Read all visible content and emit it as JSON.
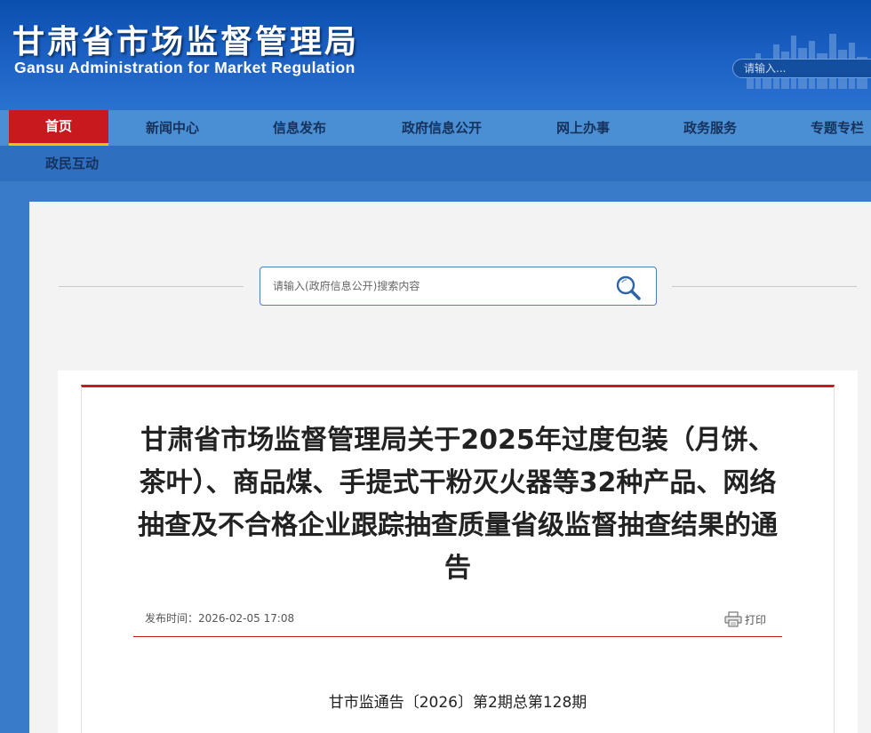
{
  "header": {
    "title_cn": "甘肃省市场监督管理局",
    "title_en": "Gansu Administration for Market Regulation",
    "search_placeholder": "请输入..."
  },
  "nav": {
    "items": [
      {
        "label": "首页",
        "active": true
      },
      {
        "label": "新闻中心"
      },
      {
        "label": "信息发布"
      },
      {
        "label": "政府信息公开"
      },
      {
        "label": "网上办事"
      },
      {
        "label": "政务服务"
      },
      {
        "label": "专题专栏"
      },
      {
        "label": "政民互动"
      }
    ]
  },
  "search": {
    "placeholder": "请输入(政府信息公开)搜索内容",
    "icon": "search-icon"
  },
  "article": {
    "title": "甘肃省市场监督管理局关于2025年过度包装（月饼、茶叶）、商品煤、手提式干粉灭火器等32种产品、网络抽查及不合格企业跟踪抽查质量省级监督抽查结果的通告",
    "publish_label": "发布时间：",
    "publish_time": "2026-02-05 17:08",
    "print_label": "打印",
    "doc_number": "甘市监通告〔2026〕第2期总第128期"
  },
  "colors": {
    "header_blue": "#0b4fae",
    "nav_blue": "#4a8ed3",
    "accent_red": "#c8191e",
    "active_underline": "#f5c400"
  }
}
